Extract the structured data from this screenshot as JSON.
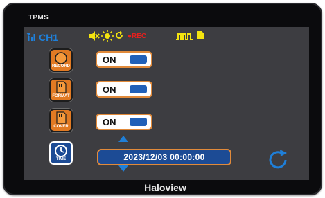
{
  "device": {
    "title": "TPMS",
    "brand": "Haloview"
  },
  "status_bar": {
    "channel": "CH1",
    "rec_label": "●REC",
    "icons": [
      "signal-icon",
      "mute-icon",
      "brightness-icon",
      "refresh-icon",
      "pulse-icon",
      "sd-card-icon"
    ],
    "colors": {
      "blue": "#1f7fd8",
      "yellow": "#f3e30f",
      "red": "#e5201e"
    }
  },
  "settings": [
    {
      "id": "record",
      "icon_caption": "RECORD",
      "state": "ON"
    },
    {
      "id": "format",
      "icon_caption": "FORMAT",
      "state": "ON"
    },
    {
      "id": "cover",
      "icon_caption": "COVER",
      "state": "ON"
    }
  ],
  "time": {
    "icon_caption": "TIME",
    "value": "2023/12/03  00:00:00"
  },
  "colors": {
    "accent_orange": "#e18a3a",
    "knob_blue": "#2060b8",
    "screen_bg": "#3d3d41"
  }
}
